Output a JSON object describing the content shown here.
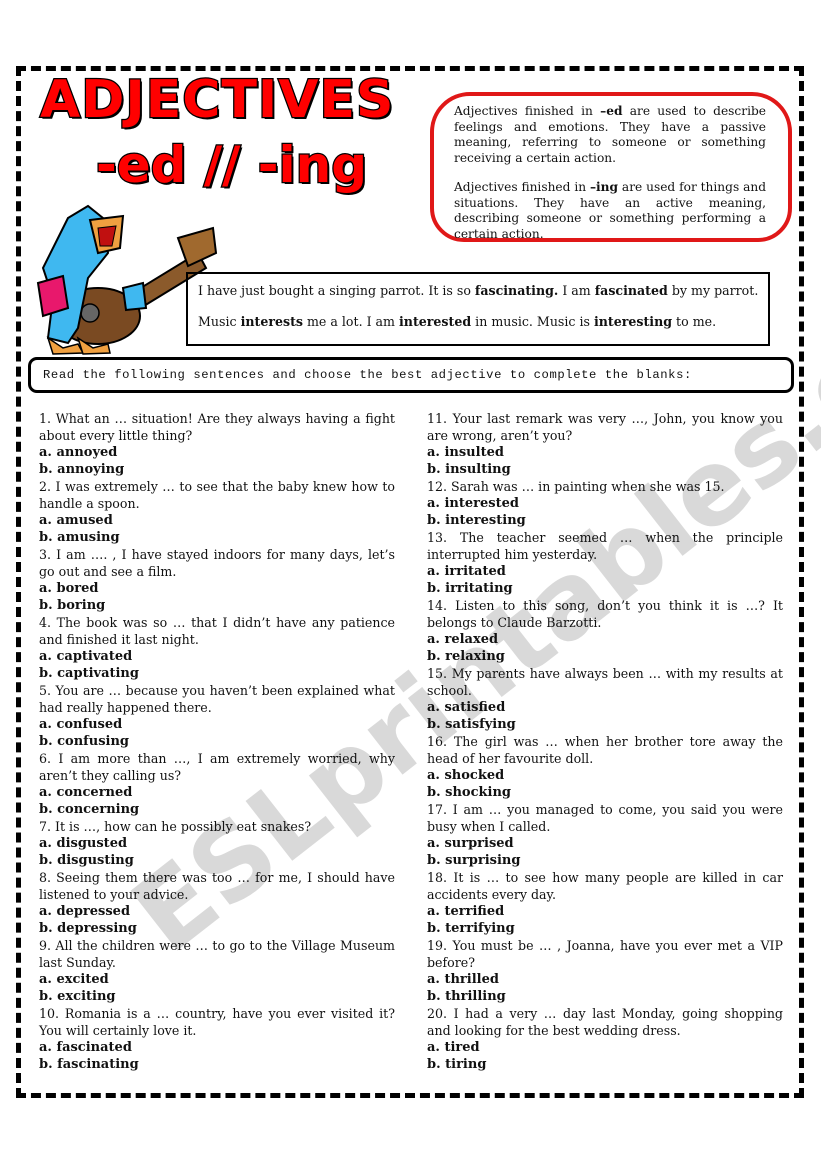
{
  "header": {
    "title": "ADJECTIVES",
    "subtitle": "-ed // -ing"
  },
  "illustration": {
    "icon": "singing-parrot-with-guitar",
    "colors": {
      "body": "#3fb8f0",
      "beak": "#f0a040",
      "sleeve": "#e8186c",
      "guitar": "#8b5a2b"
    }
  },
  "rule_box": {
    "border_color": "#e01818",
    "ed_rule": {
      "prefix": "Adjectives finished in ",
      "suffix": "–ed",
      "text": " are used to describe feelings and emotions. They have a passive meaning, referring to someone or something receiving a certain action."
    },
    "ing_rule": {
      "prefix": "Adjectives finished in ",
      "suffix": "–ing",
      "text": " are used for things and situations. They have an active meaning, describing someone or something performing a certain action."
    }
  },
  "examples": {
    "line1": {
      "a": "I have just bought a singing parrot. It is so ",
      "b": "fascinating.",
      "c": " I am ",
      "d": "fascinated",
      "e": " by my parrot."
    },
    "line2": {
      "a": "Music ",
      "b": "interests",
      "c": " me a lot. I am ",
      "d": "interested",
      "e": " in music. Music is ",
      "f": "interesting",
      "g": " to me."
    }
  },
  "instructions": "Read the following sentences and choose the best adjective to complete the blanks:",
  "questions_left": [
    {
      "q": "1. What an … situation! Are they always having a fight about every little thing?",
      "a": "a. annoyed",
      "b": "b. annoying"
    },
    {
      "q": "2. I was extremely … to see that the baby knew how to handle a spoon.",
      "a": "a. amused",
      "b": "b. amusing"
    },
    {
      "q": "3. I am …. , I have stayed indoors for many days, let’s go out and see a film.",
      "a": "a. bored",
      "b": "b. boring"
    },
    {
      "q": "4. The book was so … that I didn’t have any patience and finished it last night.",
      "a": "a. captivated",
      "b": "b. captivating"
    },
    {
      "q": "5. You are … because you haven’t been explained what had really happened there.",
      "a": "a. confused",
      "b": "b. confusing"
    },
    {
      "q": "6. I am more than …, I am extremely worried, why aren’t they calling us?",
      "a": "a. concerned",
      "b": "b. concerning"
    },
    {
      "q": "7. It is …, how can he possibly eat snakes?",
      "a": "a. disgusted",
      "b": "b. disgusting"
    },
    {
      "q": "8. Seeing them there was too … for me, I should have listened to your advice.",
      "a": "a. depressed",
      "b": "b. depressing"
    },
    {
      "q": "9. All the children were … to go to the Village Museum last Sunday.",
      "a": "a. excited",
      "b": "b. exciting"
    },
    {
      "q": "10. Romania is a … country, have you ever visited it? You will certainly love it.",
      "a": "a. fascinated",
      "b": "b. fascinating"
    }
  ],
  "questions_right": [
    {
      "q": "11. Your last remark was very …, John, you know you are wrong, aren’t you?",
      "a": "a. insulted",
      "b": "b. insulting"
    },
    {
      "q": "12. Sarah was … in painting when she was 15.",
      "a": "a. interested",
      "b": "b. interesting"
    },
    {
      "q": "13. The teacher seemed … when the principle interrupted him yesterday.",
      "a": "a. irritated",
      "b": "b. irritating"
    },
    {
      "q": "14. Listen to this song, don’t you think it is …? It belongs to Claude Barzotti.",
      "a": "a. relaxed",
      "b": "b. relaxing"
    },
    {
      "q": "15. My parents have always been … with my results at school.",
      "a": "a. satisfied",
      "b": "b. satisfying"
    },
    {
      "q": "16. The girl was … when her brother tore away the head of her favourite doll.",
      "a": "a. shocked",
      "b": "b. shocking"
    },
    {
      "q": "17. I am … you managed to come, you said you were busy when I called.",
      "a": "a. surprised",
      "b": "b. surprising"
    },
    {
      "q": "18. It is … to see how many people are killed in car accidents every day.",
      "a": "a. terrified",
      "b": "b. terrifying"
    },
    {
      "q": "19. You must be … , Joanna, have you ever met a VIP before?",
      "a": "a. thrilled",
      "b": "b. thrilling"
    },
    {
      "q": "20. I had a very … day last Monday, going shopping and looking for the best wedding dress.",
      "a": "a. tired",
      "b": "b. tiring"
    }
  ],
  "watermark": "ESLprintables.com"
}
